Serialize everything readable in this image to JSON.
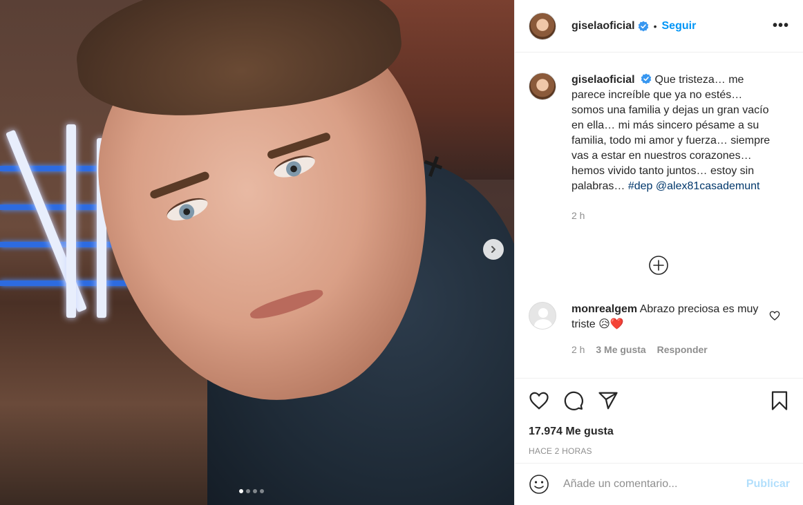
{
  "post": {
    "username": "giselaoficial",
    "separator": "•",
    "follow_label": "Seguir",
    "more_label": "•••",
    "caption_prefix": "Que tristeza… me parece increíble que ya no estés… somos una familia y dejas un gran vacío en ella… mi más sincero pésame a su familia, todo mi amor y fuerza… siempre vas a estar en nuestros corazones… hemos vivido tanto juntos… estoy sin palabras…",
    "hashtag": "#dep",
    "mention": "@alex81casademunt",
    "caption_time": "2 h",
    "image_count": 4,
    "active_image_index": 0
  },
  "comment": {
    "username": "monrealgem",
    "text": "Abrazo preciosa es muy triste 😥❤️",
    "time": "2 h",
    "likes": "3 Me gusta",
    "reply": "Responder"
  },
  "stats": {
    "likes": "17.974 Me gusta",
    "posted": "HACE 2 HORAS"
  },
  "add_comment": {
    "placeholder": "Añade un comentario...",
    "publish_label": "Publicar"
  },
  "colors": {
    "accent": "#0095f6",
    "publish_disabled": "#b2dffc",
    "link": "#00376b",
    "muted": "#8e8e8e",
    "verified": "#3897f0"
  },
  "icons": [
    "verified-badge-icon",
    "more-options-icon",
    "chevron-right-icon",
    "plus-circle-icon",
    "heart-icon",
    "comment-icon",
    "share-icon",
    "bookmark-icon",
    "emoji-icon"
  ]
}
